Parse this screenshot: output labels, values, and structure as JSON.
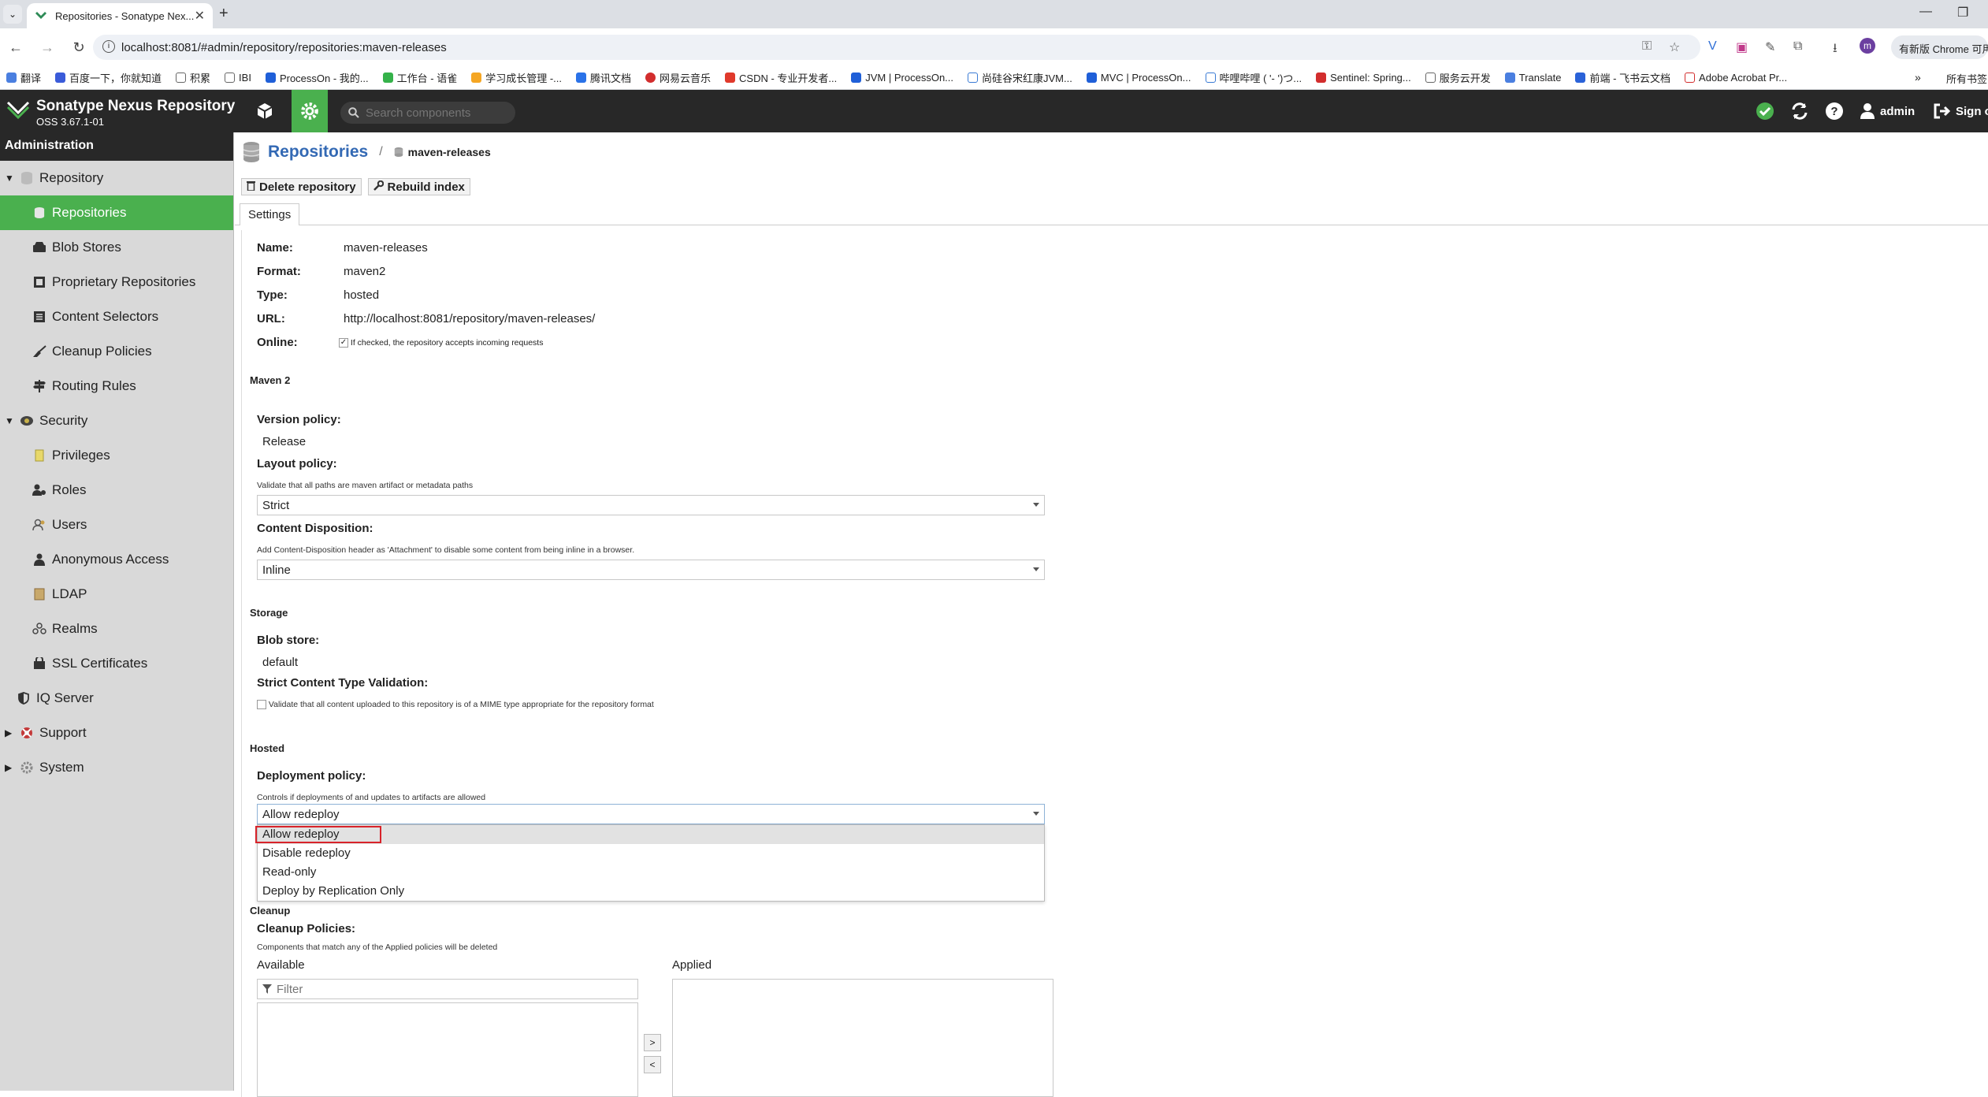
{
  "browser": {
    "tab_title": "Repositories - Sonatype Nex...",
    "tab_close": "✕",
    "new_tab": "+",
    "url": "localhost:8081/#admin/repository/repositories:maven-releases",
    "chrome_promo": "有新版 Chrome 可用",
    "bookmarks": [
      "翻译",
      "百度一下，你就知道",
      "积累",
      "IBI",
      "ProcessOn - 我的...",
      "工作台 - 语雀",
      "学习成长管理 -...",
      "腾讯文档",
      "网易云音乐",
      "CSDN - 专业开发者...",
      "JVM | ProcessOn...",
      "尚硅谷宋红康JVM...",
      "MVC | ProcessOn...",
      "哔哩哔哩 ( '- ')つ...",
      "Sentinel: Spring...",
      "服务云开发",
      "Translate",
      "前端 - 飞书云文档",
      "Adobe Acrobat Pr..."
    ],
    "bookmarks_more": "»",
    "bookmarks_all": "所有书签"
  },
  "header": {
    "title": "Sonatype Nexus Repository",
    "version": "OSS 3.67.1-01",
    "search_placeholder": "Search components",
    "user": "admin",
    "signout": "Sign out"
  },
  "sidebar": {
    "title": "Administration",
    "repository": "Repository",
    "repositories": "Repositories",
    "blob_stores": "Blob Stores",
    "proprietary": "Proprietary Repositories",
    "content_selectors": "Content Selectors",
    "cleanup_policies": "Cleanup Policies",
    "routing_rules": "Routing Rules",
    "security": "Security",
    "privileges": "Privileges",
    "roles": "Roles",
    "users": "Users",
    "anonymous": "Anonymous Access",
    "ldap": "LDAP",
    "realms": "Realms",
    "ssl": "SSL Certificates",
    "iq_server": "IQ Server",
    "support": "Support",
    "system": "System"
  },
  "main": {
    "crumb_title": "Repositories",
    "crumb_sep": "/",
    "crumb_sub": "maven-releases",
    "delete_btn": "Delete repository",
    "rebuild_btn": "Rebuild index",
    "tab_settings": "Settings",
    "name_label": "Name:",
    "name_value": "maven-releases",
    "format_label": "Format:",
    "format_value": "maven2",
    "type_label": "Type:",
    "type_value": "hosted",
    "url_label": "URL:",
    "url_value": "http://localhost:8081/repository/maven-releases/",
    "online_label": "Online:",
    "online_help": "If checked, the repository accepts incoming requests",
    "maven_section": "Maven 2",
    "version_policy_label": "Version policy:",
    "version_policy_value": "Release",
    "layout_policy_label": "Layout policy:",
    "layout_policy_help": "Validate that all paths are maven artifact or metadata paths",
    "layout_policy_value": "Strict",
    "content_disp_label": "Content Disposition:",
    "content_disp_help": "Add Content-Disposition header as 'Attachment' to disable some content from being inline in a browser.",
    "content_disp_value": "Inline",
    "storage_section": "Storage",
    "blob_store_label": "Blob store:",
    "blob_store_value": "default",
    "strict_label": "Strict Content Type Validation:",
    "strict_help": "Validate that all content uploaded to this repository is of a MIME type appropriate for the repository format",
    "hosted_section": "Hosted",
    "deploy_label": "Deployment policy:",
    "deploy_help": "Controls if deployments of and updates to artifacts are allowed",
    "deploy_value": "Allow redeploy",
    "deploy_options": [
      "Allow redeploy",
      "Disable redeploy",
      "Read-only",
      "Deploy by Replication Only"
    ],
    "cleanup_section": "Cleanup",
    "cleanup_label": "Cleanup Policies:",
    "cleanup_help": "Components that match any of the Applied policies will be deleted",
    "available_label": "Available",
    "applied_label": "Applied",
    "filter_placeholder": "Filter",
    "move_right": ">",
    "move_left": "<"
  },
  "colors": {
    "accent_green": "#4ab04e",
    "nexus_dark": "#282828",
    "link_blue": "#3369b4",
    "highlight_red": "#d8232a"
  }
}
